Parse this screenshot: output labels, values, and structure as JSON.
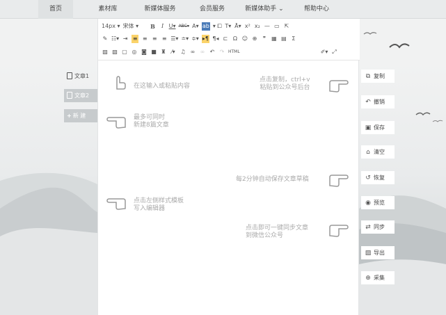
{
  "nav": {
    "items": [
      "首页",
      "素材库",
      "新媒体服务",
      "会员服务",
      "新媒体助手 ⌄",
      "帮助中心"
    ]
  },
  "docs": {
    "items": [
      "文章1",
      "文章2"
    ],
    "new_label": "新 建"
  },
  "toolbar": {
    "font_size": "14px",
    "font_family": "宋体",
    "html_label": "HTML"
  },
  "hints": {
    "input": "在这输入或粘贴内容",
    "copy_line1": "点击复制，ctrl+v",
    "copy_line2": "粘贴到公众号后台",
    "max_line1": "最多可同时",
    "max_line2": "新建8篇文章",
    "autosave": "每2分钟自动保存文章草稿",
    "template_line1": "点击左侧样式模板",
    "template_line2": "写入编辑器",
    "sync_line1": "点击即可一键同步文章",
    "sync_line2": "到微信公众号"
  },
  "actions": {
    "copy": "复制",
    "undo": "撤销",
    "save": "保存",
    "clear": "清空",
    "restore": "恢复",
    "preview": "预览",
    "sync": "同步",
    "export": "导出",
    "collect": "采集"
  },
  "icons": {
    "hand": "pointing-hand-icon",
    "doc": "document-icon",
    "plus": "plus-icon"
  }
}
